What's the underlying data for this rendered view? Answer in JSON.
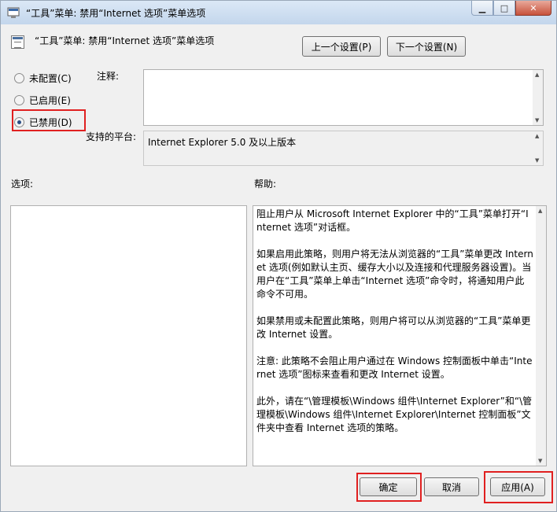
{
  "window": {
    "title": "“工具”菜单: 禁用“Internet 选项”菜单选项"
  },
  "header": {
    "title": "“工具”菜单: 禁用“Internet 选项”菜单选项"
  },
  "nav": {
    "prev_label": "上一个设置(P)",
    "next_label": "下一个设置(N)"
  },
  "radios": [
    {
      "label": "未配置(C)",
      "checked": false
    },
    {
      "label": "已启用(E)",
      "checked": false
    },
    {
      "label": "已禁用(D)",
      "checked": true
    }
  ],
  "comment": {
    "label": "注释:",
    "value": ""
  },
  "platform": {
    "label": "支持的平台:",
    "value": "Internet Explorer 5.0 及以上版本"
  },
  "options": {
    "label": "选项:"
  },
  "help": {
    "label": "帮助:",
    "paragraphs": [
      "阻止用户从 Microsoft Internet Explorer 中的“工具”菜单打开“Internet 选项”对话框。",
      "如果启用此策略，则用户将无法从浏览器的“工具”菜单更改 Internet 选项(例如默认主页、缓存大小以及连接和代理服务器设置)。当用户在“工具”菜单上单击“Internet 选项”命令时，将通知用户此命令不可用。",
      "如果禁用或未配置此策略，则用户将可以从浏览器的“工具”菜单更改 Internet 设置。",
      "注意: 此策略不会阻止用户通过在 Windows 控制面板中单击“Internet 选项”图标来查看和更改 Internet 设置。",
      "此外，请在“\\管理模板\\Windows 组件\\Internet Explorer”和“\\管理模板\\Windows 组件\\Internet Explorer\\Internet 控制面板”文件夹中查看 Internet 选项的策略。"
    ]
  },
  "footer": {
    "ok_label": "确定",
    "cancel_label": "取消",
    "apply_label": "应用(A)"
  },
  "colors": {
    "highlight": "#e02020",
    "radio_checked": "#2a4d84"
  }
}
